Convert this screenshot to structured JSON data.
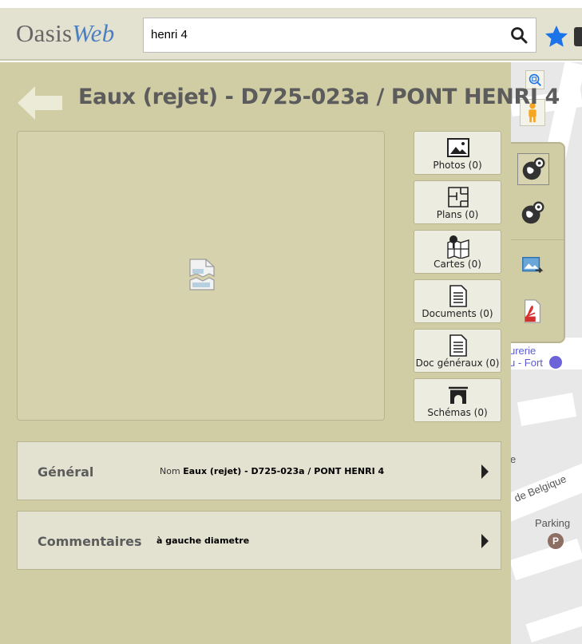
{
  "app": {
    "logo_main": "Oasis",
    "logo_accent": "Web"
  },
  "search": {
    "value": "henri 4",
    "icon": "search-icon"
  },
  "toolbar": {
    "favorite_icon": "star-icon"
  },
  "record": {
    "title": "Eaux (rejet) - D725-023a / PONT HENRI 4"
  },
  "media_buttons": [
    {
      "label": "Photos (0)",
      "icon": "image-icon"
    },
    {
      "label": "Plans (0)",
      "icon": "floor-plan-icon"
    },
    {
      "label": "Cartes (0)",
      "icon": "map-pin-icon"
    },
    {
      "label": "Documents (0)",
      "icon": "document-icon"
    },
    {
      "label": "Doc généraux (0)",
      "icon": "document-icon"
    },
    {
      "label": "Schémas (0)",
      "icon": "bridge-icon"
    }
  ],
  "sections": [
    {
      "title": "Général",
      "value_prefix": "Nom",
      "value": "Eaux (rejet) - D725-023a / PONT HENRI 4"
    },
    {
      "title": "Commentaires",
      "value_prefix": "",
      "value": "à gauche diametre"
    }
  ],
  "map": {
    "labels": [
      "urerie",
      "u - Fort",
      "e",
      "de Belgique",
      "Parking"
    ],
    "parking_marker": "P"
  },
  "colors": {
    "panel_bg": "#d0cca4",
    "header_bg": "#e3e2d1",
    "accent_blue": "#1a73e8"
  }
}
